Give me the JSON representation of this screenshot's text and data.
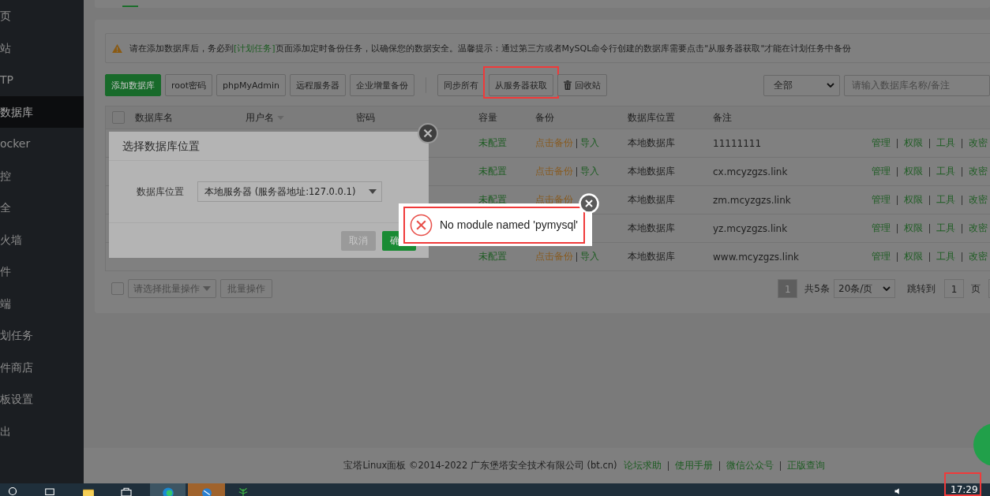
{
  "sidebar": {
    "items": [
      {
        "label": "页",
        "selected": false
      },
      {
        "label": "站",
        "selected": false
      },
      {
        "label": "TP",
        "selected": false
      },
      {
        "label": "数据库",
        "selected": true
      },
      {
        "label": "ocker",
        "selected": false
      },
      {
        "label": "控",
        "selected": false
      },
      {
        "label": "全",
        "selected": false
      },
      {
        "label": "火墙",
        "selected": false
      },
      {
        "label": "件",
        "selected": false
      },
      {
        "label": "端",
        "selected": false
      },
      {
        "label": "划任务",
        "selected": false
      },
      {
        "label": "件商店",
        "selected": false
      },
      {
        "label": "板设置",
        "selected": false
      },
      {
        "label": "出",
        "selected": false
      }
    ]
  },
  "alert": {
    "text_before": "请在添加数据库后，务必到",
    "link": "[计划任务]",
    "text_after": "页面添加定时备份任务，以确保您的数据安全。温馨提示：通过第三方或者MySQL命令行创建的数据库需要点击\"从服务器获取\"才能在计划任务中备份"
  },
  "toolbar": {
    "buttons": [
      {
        "label": "添加数据库",
        "kind": "primary",
        "highlighted": false
      },
      {
        "label": "root密码",
        "kind": "default",
        "highlighted": false
      },
      {
        "label": "phpMyAdmin",
        "kind": "default",
        "highlighted": false
      },
      {
        "label": "远程服务器",
        "kind": "default",
        "highlighted": false
      },
      {
        "label": "企业增量备份",
        "kind": "default",
        "highlighted": false
      },
      {
        "label": "同步所有",
        "kind": "group",
        "highlighted": false
      },
      {
        "label": "从服务器获取",
        "kind": "default",
        "highlighted": true
      },
      {
        "label": "回收站",
        "kind": "trash",
        "highlighted": false
      }
    ],
    "filter": "全部",
    "search_placeholder": "请输入数据库名称/备注"
  },
  "table": {
    "select_all_checked": false,
    "columns": [
      "数据库名",
      "用户名",
      "密码",
      "容量",
      "备份",
      "数据库位置",
      "备注"
    ],
    "rows": [
      {
        "capacity": "未配置",
        "backup": "点击备份",
        "import": "导入",
        "location": "本地数据库",
        "note": "11111111",
        "actions": [
          "管理",
          "权限",
          "工具",
          "改密"
        ]
      },
      {
        "capacity": "未配置",
        "backup": "点击备份",
        "import": "导入",
        "location": "本地数据库",
        "note": "cx.mcyzgzs.link",
        "actions": [
          "管理",
          "权限",
          "工具",
          "改密"
        ]
      },
      {
        "capacity": "未配置",
        "backup": "点击备份",
        "location": "本地数据库",
        "note": "zm.mcyzgzs.link",
        "actions": [
          "管理",
          "权限",
          "工具",
          "改密"
        ]
      },
      {
        "location": "本地数据库",
        "note": "yz.mcyzgzs.link",
        "actions": [
          "管理",
          "权限",
          "工具",
          "改密"
        ]
      },
      {
        "capacity": "未配置",
        "backup": "点击备份",
        "import": "导入",
        "location": "本地数据库",
        "note": "www.mcyzgzs.link",
        "actions": [
          "管理",
          "权限",
          "工具",
          "改密"
        ]
      }
    ]
  },
  "batch": {
    "checked": false,
    "placeholder": "请选择批量操作",
    "button": "批量操作"
  },
  "pagination": {
    "pages": [
      {
        "label": "1",
        "selected": true
      }
    ],
    "total": "共5条",
    "per_page": "20条/页",
    "jump_label": "跳转到",
    "jump_value": "1",
    "page_unit": "页"
  },
  "dialog": {
    "title": "选择数据库位置",
    "field_label": "数据库位置",
    "field_value": "本地服务器 (服务器地址:127.0.0.1)",
    "buttons": [
      {
        "label": "取消",
        "kind": "cancel"
      },
      {
        "label": "确",
        "kind": "confirm"
      }
    ]
  },
  "toast": {
    "message": "No module named 'pymysql'",
    "kind": "error",
    "highlighted": true
  },
  "footer": {
    "copyright": "宝塔Linux面板 ©2014-2022 广东堡塔安全技术有限公司 (bt.cn)",
    "links": [
      "论坛求助",
      "使用手册",
      "微信公众号",
      "正版查询"
    ]
  },
  "taskbar": {
    "clock": "17:29",
    "highlighted": true
  }
}
